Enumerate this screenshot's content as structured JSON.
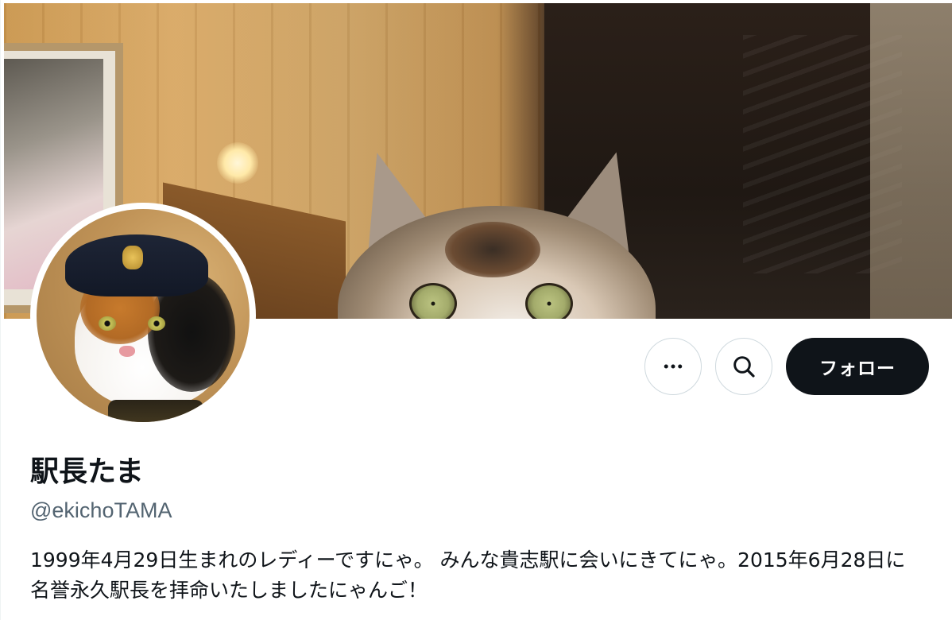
{
  "profile": {
    "display_name": "駅長たま",
    "handle": "@ekichoTAMA",
    "bio": "1999年4月29日生まれのレディーですにゃ。 みんな貴志駅に会いにきてにゃ。2015年6月28日に名誉永久駅長を拝命いたしましたにゃんご！"
  },
  "actions": {
    "more_icon": "more-horizontal-icon",
    "search_icon": "search-icon",
    "follow_label": "フォロー"
  },
  "colors": {
    "text_primary": "#0f1419",
    "text_secondary": "#536471",
    "button_border": "#cfd9de",
    "follow_bg": "#0f1419",
    "follow_text": "#ffffff"
  }
}
